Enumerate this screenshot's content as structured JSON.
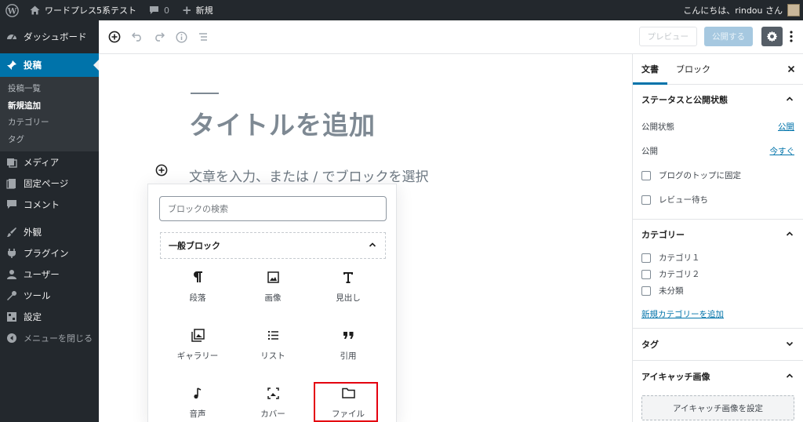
{
  "admin_bar": {
    "site_name": "ワードプレス5系テスト",
    "comments_count": "0",
    "new_label": "新規",
    "greeting": "こんにちは、rindou さん"
  },
  "sidebar": {
    "dashboard": "ダッシュボード",
    "posts": "投稿",
    "posts_submenu": [
      "投稿一覧",
      "新規追加",
      "カテゴリー",
      "タグ"
    ],
    "media": "メディア",
    "pages": "固定ページ",
    "comments": "コメント",
    "appearance": "外観",
    "plugins": "プラグイン",
    "users": "ユーザー",
    "tools": "ツール",
    "settings": "設定",
    "collapse": "メニューを閉じる"
  },
  "toolbar": {
    "preview_label": "プレビュー",
    "publish_label": "公開する"
  },
  "editor": {
    "title_placeholder": "タイトルを追加",
    "block_placeholder": "文章を入力、または / でブロックを選択"
  },
  "inserter": {
    "search_placeholder": "ブロックの検索",
    "panel_title": "一般ブロック",
    "blocks": [
      "段落",
      "画像",
      "見出し",
      "ギャラリー",
      "リスト",
      "引用",
      "音声",
      "カバー",
      "ファイル"
    ],
    "icons": [
      "paragraph-icon",
      "image-icon",
      "heading-icon",
      "gallery-icon",
      "list-icon",
      "quote-icon",
      "audio-icon",
      "cover-icon",
      "file-icon"
    ]
  },
  "settings_panel": {
    "tab_document": "文書",
    "tab_block": "ブロック",
    "status_title": "ステータスと公開状態",
    "visibility_label": "公開状態",
    "visibility_value": "公開",
    "publish_label": "公開",
    "publish_value": "今すぐ",
    "sticky_label": "ブログのトップに固定",
    "pending_label": "レビュー待ち",
    "categories_title": "カテゴリー",
    "categories": [
      "カテゴリ１",
      "カテゴリ２",
      "未分類"
    ],
    "add_category": "新規カテゴリーを追加",
    "tags_title": "タグ",
    "featured_title": "アイキャッチ画像",
    "featured_button": "アイキャッチ画像を設定"
  },
  "colors": {
    "admin_dark": "#23282d",
    "accent": "#0073aa",
    "highlight_red": "#e4000f"
  }
}
